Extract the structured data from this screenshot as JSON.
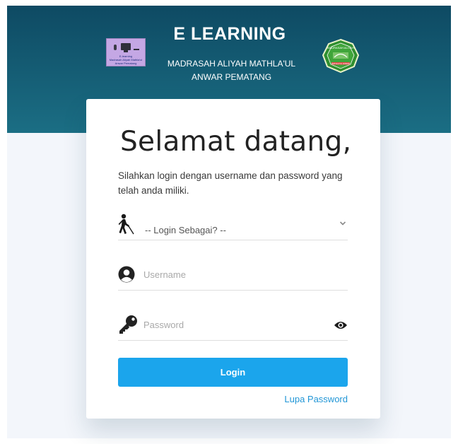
{
  "header": {
    "title": "E LEARNING",
    "subtitle_line1": "MADRASAH ALIYAH MATHLA'UL",
    "subtitle_line2": "ANWAR PEMATANG",
    "band_color": "#114f68"
  },
  "logo": {
    "icon": "elearning-logo-icon",
    "text_line1": "E-learning",
    "text_line2": "Madrasah Aliyah Mathla'ul Anwar Pematang",
    "background": "#c4a7e4"
  },
  "seal": {
    "icon": "madrasah-seal-icon",
    "text_top": "MADRASAH ALIYAH",
    "text_bottom": "MATHLA'UL ANWAR",
    "color": "#2f8f2f"
  },
  "login_card": {
    "welcome": "Selamat datang,",
    "instructions": "Silahkan login dengan username dan password yang telah anda miliki.",
    "role_select": {
      "icon": "person-cane-icon",
      "selected": "-- Login Sebagai? --",
      "dropdown_icon": "chevron-down-icon"
    },
    "username": {
      "icon": "user-circle-icon",
      "placeholder": "Username"
    },
    "password": {
      "icon": "key-icon",
      "placeholder": "Password",
      "toggle_icon": "eye-icon"
    },
    "login_button": "Login",
    "forgot_link": "Lupa Password",
    "accent_color": "#1ba5ec"
  }
}
